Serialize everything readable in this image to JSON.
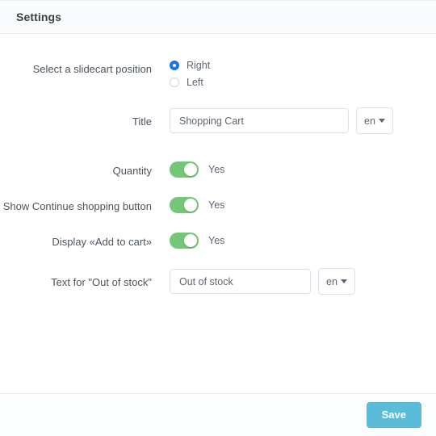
{
  "header": {
    "title": "Settings"
  },
  "form": {
    "position_row": {
      "label": "Select a slidecart position",
      "options": [
        {
          "label": "Right",
          "selected": true
        },
        {
          "label": "Left",
          "selected": false
        }
      ]
    },
    "title_row": {
      "label": "Title",
      "value": "Shopping Cart",
      "placeholder": "Title",
      "lang": "en"
    },
    "quantity_row": {
      "label": "Quantity",
      "state_label": "Yes",
      "enabled": true
    },
    "continue_shopping_row": {
      "label": "Show Continue shopping button",
      "state_label": "Yes",
      "enabled": true
    },
    "add_to_cart_row": {
      "label": "Display «Add to cart»",
      "state_label": "Yes",
      "enabled": true
    },
    "out_of_stock_row": {
      "label": "Text for \"Out of stock\"",
      "value": "Out of stock",
      "placeholder": "Out of stock",
      "lang": "en"
    }
  },
  "footer": {
    "save_label": "Save"
  },
  "colors": {
    "accent_blue": "#1a73e8",
    "toggle_green": "#73c776",
    "save_blue": "#5bbcd9",
    "header_bg": "#fafbfc",
    "border": "#dde1e7"
  }
}
